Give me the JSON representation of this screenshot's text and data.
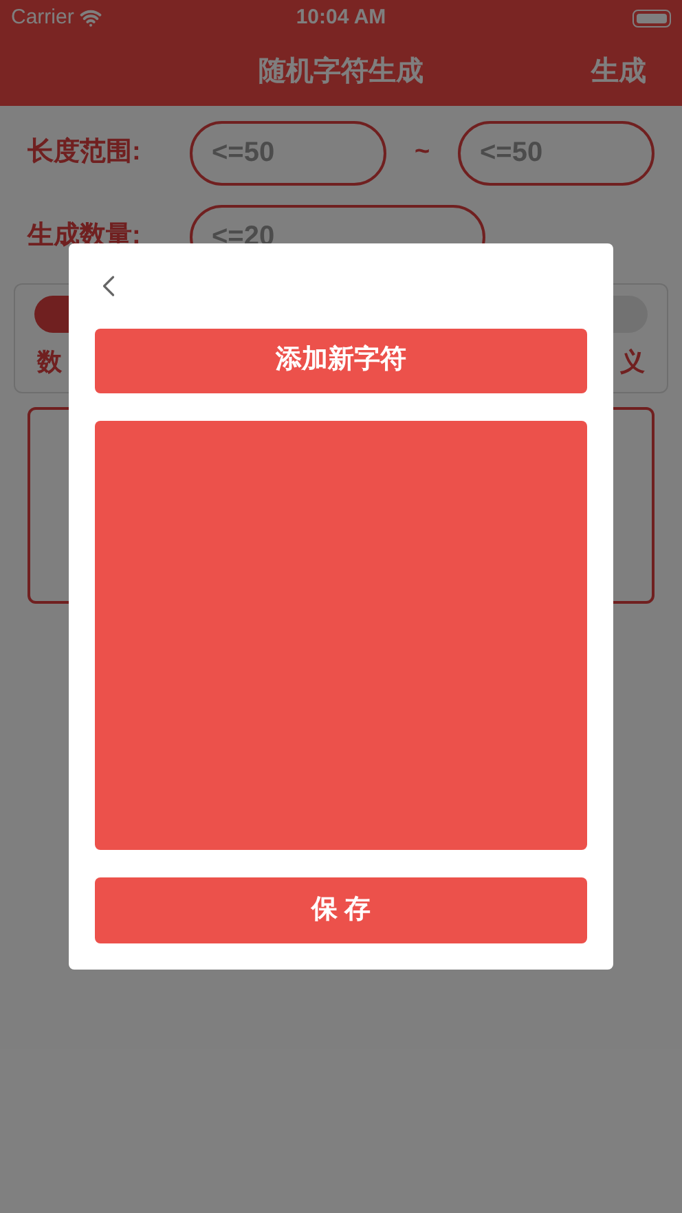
{
  "status_bar": {
    "carrier": "Carrier",
    "time": "10:04 AM"
  },
  "nav": {
    "title": "随机字符生成",
    "action": "生成"
  },
  "form": {
    "length_label": "长度范围:",
    "min_placeholder": "<=50",
    "separator": "~",
    "max_placeholder": "<=50",
    "count_label": "生成数量:",
    "count_placeholder": "<=20"
  },
  "options": [
    {
      "label": "数",
      "selected": true
    },
    {
      "label": "义",
      "selected": false
    }
  ],
  "dialog": {
    "add_button": "添加新字符",
    "save_button": "保 存"
  }
}
